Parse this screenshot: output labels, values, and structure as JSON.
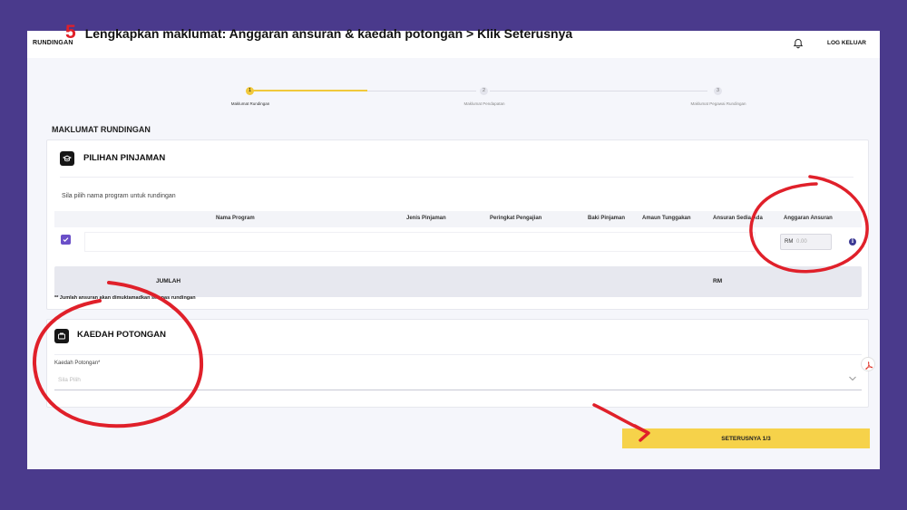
{
  "header": {
    "brand": "RUNDINGAN",
    "logout": "LOG KELUAR",
    "bell_icon": "bell-icon"
  },
  "instruction": {
    "number": "5",
    "text": "Lengkapkan maklumat: Anggaran ansuran & kaedah potongan > Klik Seterusnya"
  },
  "stepper": {
    "steps": [
      {
        "number": "1",
        "label": "Maklumat Rundingan"
      },
      {
        "number": "2",
        "label": "Maklumat Pendapatan"
      },
      {
        "number": "3",
        "label": "Maklumat Pegawai Rundingan"
      }
    ],
    "current": 1
  },
  "section_title": "MAKLUMAT RUNDINGAN",
  "pilihan": {
    "title": "PILIHAN PINJAMAN",
    "hint": "Sila pilih nama program untuk rundingan",
    "columns": [
      "Nama Program",
      "Jenis Pinjaman",
      "Peringkat Pengajian",
      "Baki Pinjaman",
      "Amaun Tunggakan",
      "Ansuran Sedia Ada",
      "Anggaran Ansuran"
    ],
    "row": {
      "checked": true,
      "rm_prefix": "RM",
      "rm_value": "0.00"
    },
    "total_label": "JUMLAH",
    "total_rm": "RM",
    "footnote": "** Jumlah ansuran akan dimuktamadkan selepas rundingan"
  },
  "kaedah": {
    "title": "KAEDAH POTONGAN",
    "field_label": "Kaedah Potongan*",
    "placeholder": "Sila Pilih"
  },
  "next_button": "SETERUSNYA 1/3",
  "colors": {
    "accent_yellow": "#f6d24a",
    "annotation_red": "#e0202a",
    "frame_purple": "#4a3a8c",
    "checkbox_purple": "#6a4fc8"
  }
}
